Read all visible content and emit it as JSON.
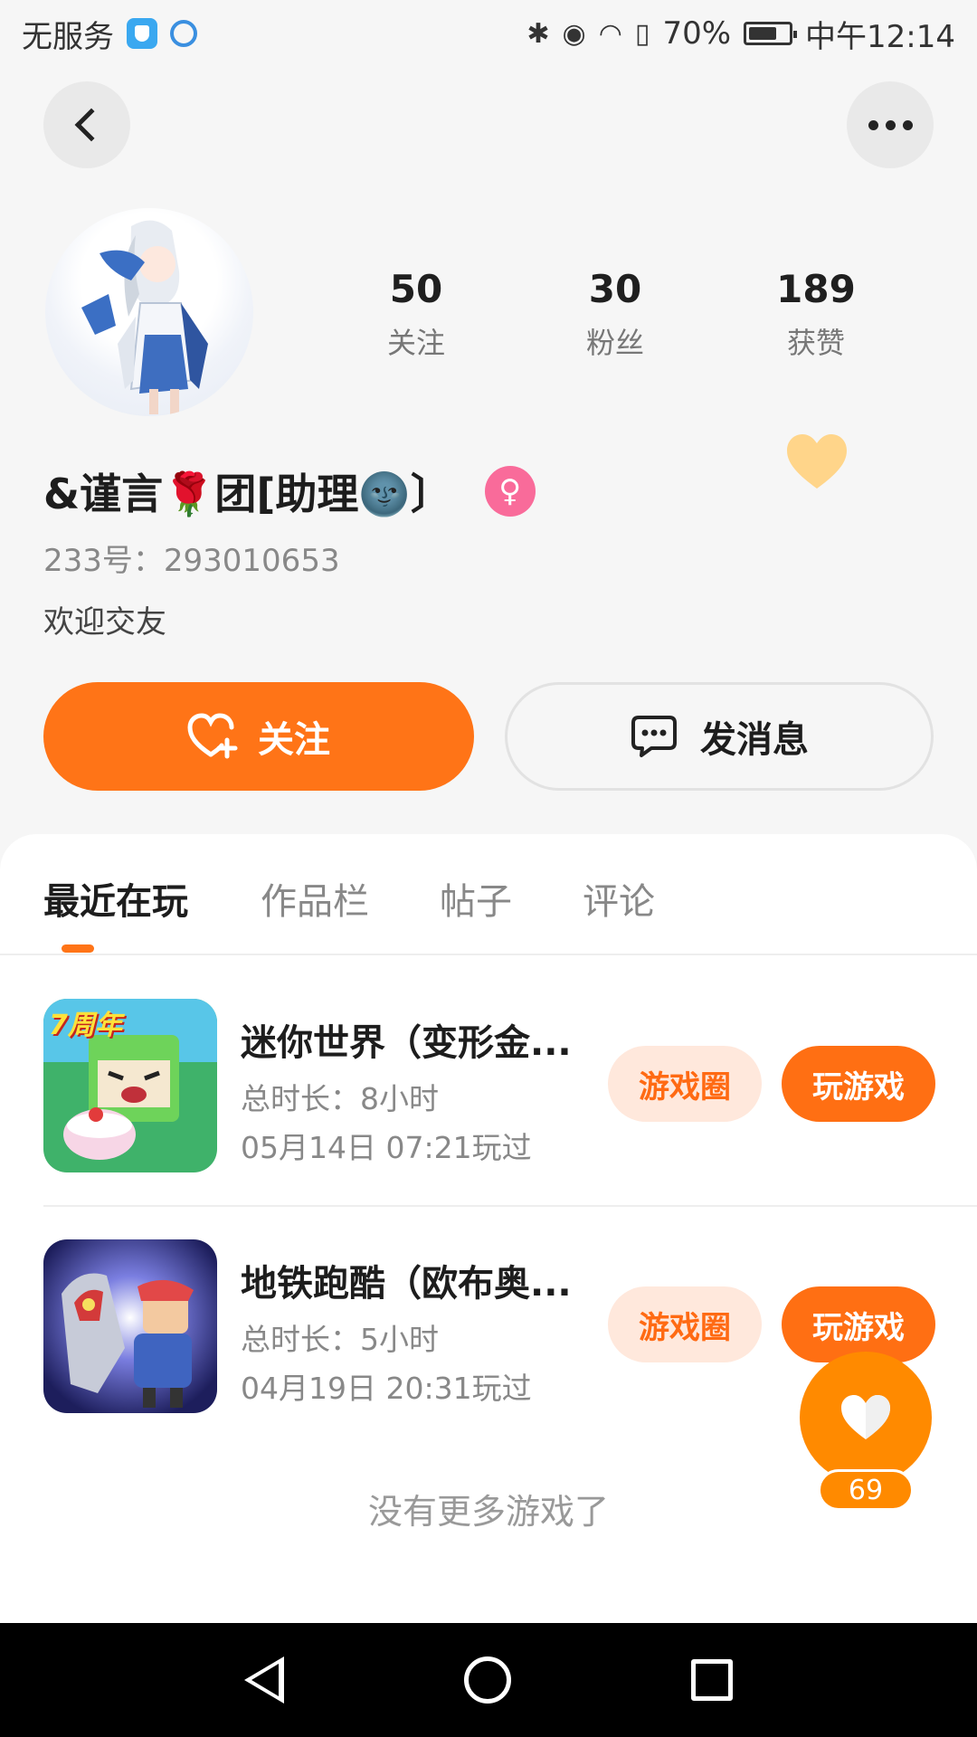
{
  "status_bar": {
    "carrier": "无服务",
    "battery": "70%",
    "time": "中午12:14"
  },
  "profile": {
    "stats": [
      {
        "value": "50",
        "label": "关注"
      },
      {
        "value": "30",
        "label": "粉丝"
      },
      {
        "value": "189",
        "label": "获赞"
      }
    ],
    "name": "&谨言🌹团[助理🌚〕",
    "gender_symbol": "♀",
    "id_line": "233号：293010653",
    "bio": "欢迎交友"
  },
  "actions": {
    "follow_label": "关注",
    "message_label": "发消息"
  },
  "tabs": [
    {
      "label": "最近在玩",
      "active": true
    },
    {
      "label": "作品栏",
      "active": false
    },
    {
      "label": "帖子",
      "active": false
    },
    {
      "label": "评论",
      "active": false
    }
  ],
  "games": [
    {
      "title": "迷你世界（变形金...",
      "duration": "总时长：8小时",
      "last_played": "05月14日 07:21玩过",
      "circle_label": "游戏圈",
      "play_label": "玩游戏",
      "icon_badge": "7周年"
    },
    {
      "title": "地铁跑酷（欧布奥...",
      "duration": "总时长：5小时",
      "last_played": "04月19日 20:31玩过",
      "circle_label": "游戏圈",
      "play_label": "玩游戏"
    }
  ],
  "no_more_text": "没有更多游戏了",
  "like_count": "69",
  "colors": {
    "accent": "#ff7417",
    "accent_light": "#ffe8dc",
    "gender": "#f96b9a"
  }
}
